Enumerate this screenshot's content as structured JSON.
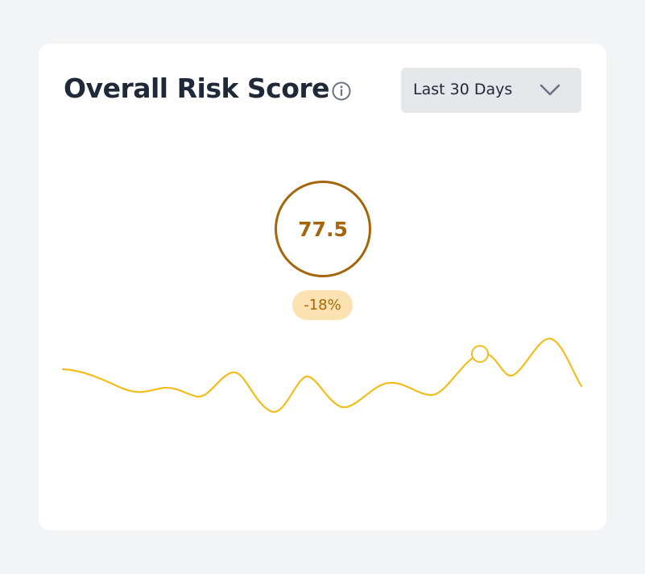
{
  "card": {
    "title": "Overall Risk Score",
    "info_icon": "info-circle-icon",
    "range_selector": {
      "selected": "Last 30 Days",
      "icon": "chevron-down-icon"
    }
  },
  "score": {
    "value": "77.5",
    "change": "-18%"
  },
  "sparkline": {
    "highlighted_point_index": 11
  },
  "colors": {
    "background": "#f3f4f6",
    "card": "#ffffff",
    "title": "#1f2937",
    "score_accent": "#a5650a",
    "badge_bg": "#fde2b1",
    "line": "#f2bd1d",
    "dropdown_bg": "#e5e7eb"
  }
}
